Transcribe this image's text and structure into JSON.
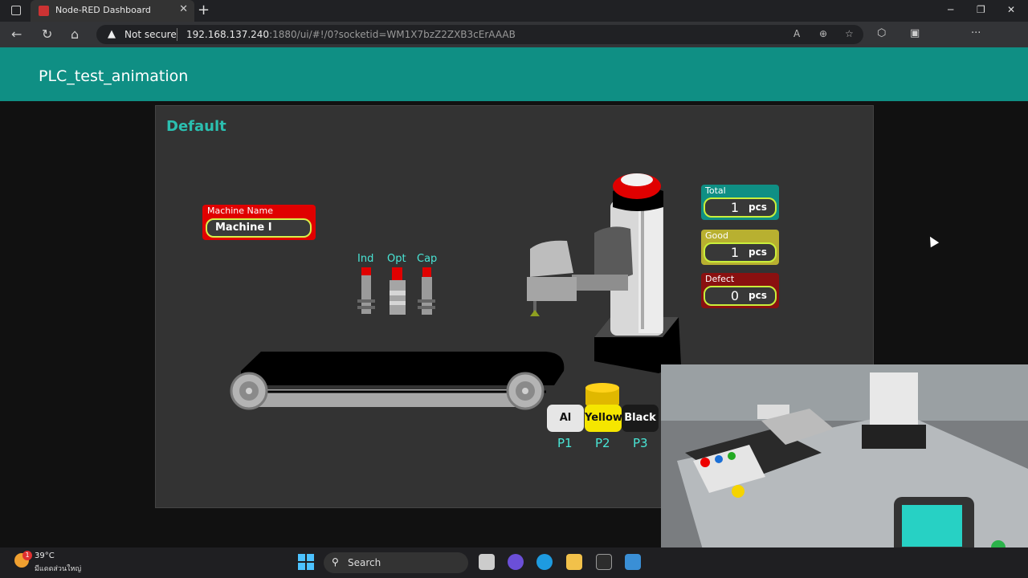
{
  "browser": {
    "tab_title": "Node-RED Dashboard",
    "security_label": "Not secure",
    "url_host": "192.168.137.240",
    "url_path": ":1880/ui/#!/0?socketid=WM1X7bzZ2ZXB3cErAAAB"
  },
  "dashboard": {
    "title": "PLC_test_animation",
    "group_title": "Default"
  },
  "machine": {
    "label": "Machine Name",
    "value": "Machine I"
  },
  "sensors": [
    "Ind",
    "Opt",
    "Cap"
  ],
  "counters": [
    {
      "label": "Total",
      "value": "1",
      "unit": "pcs",
      "color": "#0f8f84"
    },
    {
      "label": "Good",
      "value": "1",
      "unit": "pcs",
      "color": "#b8b030"
    },
    {
      "label": "Defect",
      "value": "0",
      "unit": "pcs",
      "color": "#8a1010"
    }
  ],
  "materials": [
    {
      "button": "Al",
      "position": "P1",
      "bg": "#e6e6e6",
      "fg": "#111"
    },
    {
      "button": "Yellow",
      "position": "P2",
      "bg": "#f5e600",
      "fg": "#111"
    },
    {
      "button": "Black",
      "position": "P3",
      "bg": "#1a1a1a",
      "fg": "#fff"
    }
  ],
  "taskbar": {
    "temperature": "39°C",
    "weather": "มีแดดส่วนใหญ่",
    "search_label": "Search",
    "notification_count": "1"
  }
}
